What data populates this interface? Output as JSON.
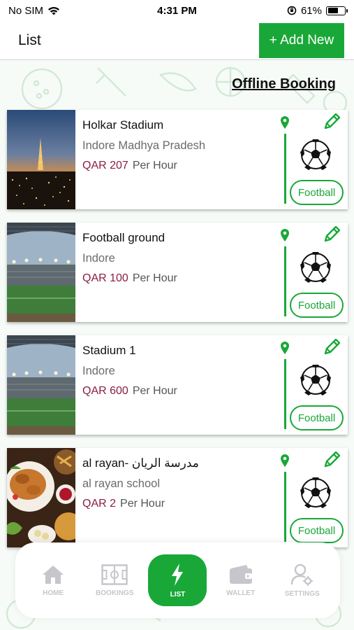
{
  "status": {
    "carrier": "No SIM",
    "time": "4:31 PM",
    "battery_pct": "61%",
    "battery_level": 0.61
  },
  "header": {
    "title": "List",
    "add_label": "+ Add New"
  },
  "offline_label": "Offline Booking",
  "venues": [
    {
      "name": "Holkar Stadium",
      "location": "Indore Madhya Pradesh",
      "price": "QAR 207",
      "unit": "Per Hour",
      "sport": "Football",
      "image": "city-night"
    },
    {
      "name": "Football ground",
      "location": "Indore",
      "price": "QAR 100",
      "unit": "Per Hour",
      "sport": "Football",
      "image": "stadium"
    },
    {
      "name": "Stadium 1",
      "location": "Indore",
      "price": "QAR 600",
      "unit": "Per Hour",
      "sport": "Football",
      "image": "stadium"
    },
    {
      "name": "al rayan- مدرسة الريان",
      "location": "al rayan school",
      "price": "QAR 2",
      "unit": "Per Hour",
      "sport": "Football",
      "image": "food"
    }
  ],
  "nav": [
    {
      "label": "HOME",
      "icon": "home-icon",
      "active": false
    },
    {
      "label": "BOOKINGS",
      "icon": "field-icon",
      "active": false
    },
    {
      "label": "LIST",
      "icon": "bolt-icon",
      "active": true
    },
    {
      "label": "WALLET",
      "icon": "wallet-icon",
      "active": false
    },
    {
      "label": "SETTINGS",
      "icon": "user-settings-icon",
      "active": false
    }
  ],
  "colors": {
    "accent": "#19a838",
    "price": "#8a1f3f"
  }
}
